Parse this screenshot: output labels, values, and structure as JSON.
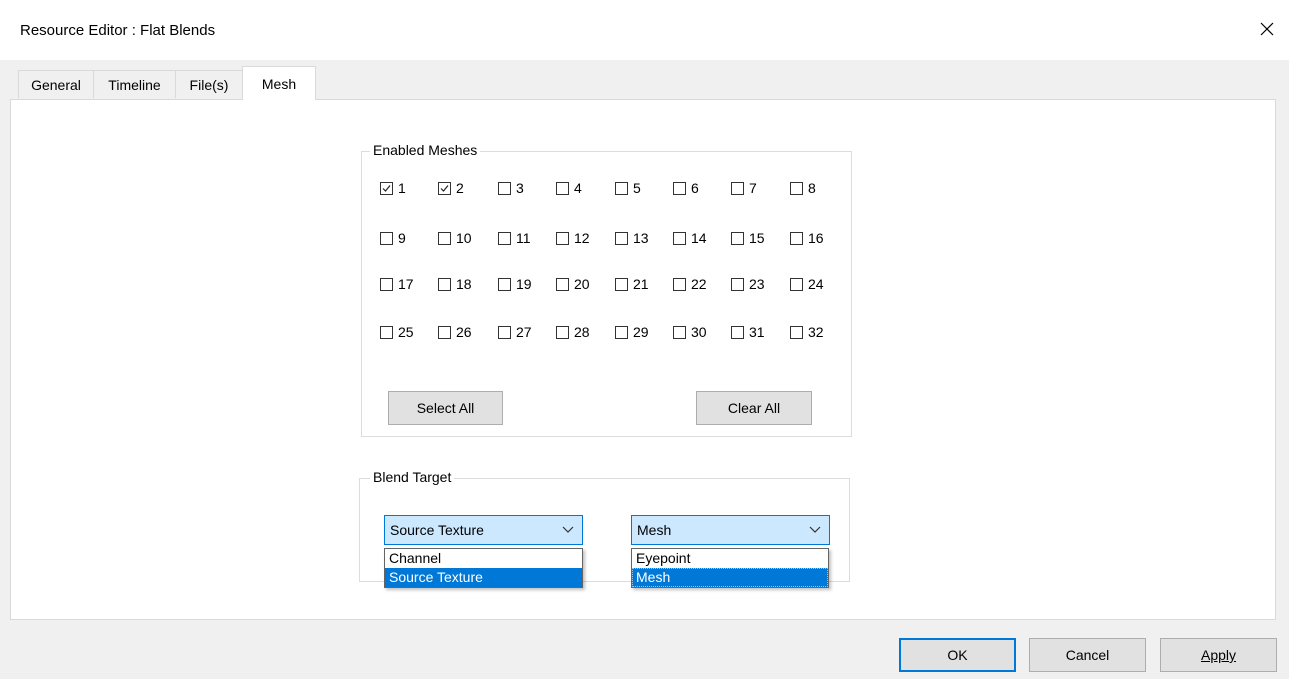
{
  "window": {
    "title": "Resource Editor  :  Flat Blends"
  },
  "tabs": [
    {
      "label": "General",
      "active": false
    },
    {
      "label": "Timeline",
      "active": false
    },
    {
      "label": "File(s)",
      "active": false
    },
    {
      "label": "Mesh",
      "active": true
    }
  ],
  "enabled_meshes": {
    "label": "Enabled Meshes",
    "meshes": [
      {
        "n": "1",
        "checked": true
      },
      {
        "n": "2",
        "checked": true
      },
      {
        "n": "3",
        "checked": false
      },
      {
        "n": "4",
        "checked": false
      },
      {
        "n": "5",
        "checked": false
      },
      {
        "n": "6",
        "checked": false
      },
      {
        "n": "7",
        "checked": false
      },
      {
        "n": "8",
        "checked": false
      },
      {
        "n": "9",
        "checked": false
      },
      {
        "n": "10",
        "checked": false
      },
      {
        "n": "11",
        "checked": false
      },
      {
        "n": "12",
        "checked": false
      },
      {
        "n": "13",
        "checked": false
      },
      {
        "n": "14",
        "checked": false
      },
      {
        "n": "15",
        "checked": false
      },
      {
        "n": "16",
        "checked": false
      },
      {
        "n": "17",
        "checked": false
      },
      {
        "n": "18",
        "checked": false
      },
      {
        "n": "19",
        "checked": false
      },
      {
        "n": "20",
        "checked": false
      },
      {
        "n": "21",
        "checked": false
      },
      {
        "n": "22",
        "checked": false
      },
      {
        "n": "23",
        "checked": false
      },
      {
        "n": "24",
        "checked": false
      },
      {
        "n": "25",
        "checked": false
      },
      {
        "n": "26",
        "checked": false
      },
      {
        "n": "27",
        "checked": false
      },
      {
        "n": "28",
        "checked": false
      },
      {
        "n": "29",
        "checked": false
      },
      {
        "n": "30",
        "checked": false
      },
      {
        "n": "31",
        "checked": false
      },
      {
        "n": "32",
        "checked": false
      }
    ],
    "select_all_label": "Select All",
    "clear_all_label": "Clear All"
  },
  "blend_target": {
    "label": "Blend Target",
    "combo1": {
      "value": "Source Texture",
      "options": [
        {
          "label": "Channel",
          "selected": false
        },
        {
          "label": "Source Texture",
          "selected": true
        }
      ]
    },
    "combo2": {
      "value": "Mesh",
      "options": [
        {
          "label": "Eyepoint",
          "selected": false
        },
        {
          "label": "Mesh",
          "selected": true
        }
      ]
    }
  },
  "footer": {
    "ok_label": "OK",
    "cancel_label": "Cancel",
    "apply_label": "Apply"
  }
}
